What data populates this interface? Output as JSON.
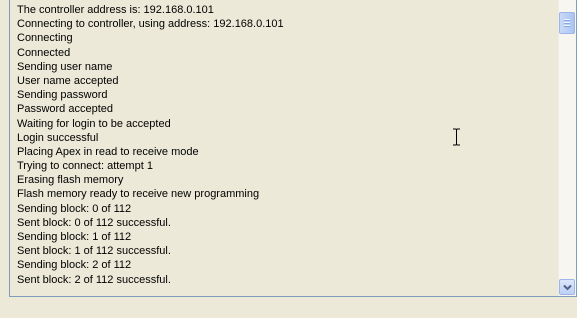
{
  "log": {
    "lines": [
      "The controller address is: 192.168.0.101",
      "Connecting to controller, using address: 192.168.0.101",
      "Connecting",
      "Connected",
      "Sending user name",
      "User name accepted",
      "Sending password",
      "Password accepted",
      "Waiting for login to be accepted",
      "Login successful",
      "Placing Apex in read to receive mode",
      "Trying to connect: attempt 1",
      "Erasing flash memory",
      "Flash memory ready to receive new programming",
      "Sending block: 0 of 112",
      "Sent block: 0 of 112 successful.",
      "Sending block: 1 of 112",
      "Sent block: 1 of 112 successful.",
      "Sending block: 2 of 112",
      "Sent block: 2 of 112 successful."
    ]
  },
  "scrollbar": {
    "thumb_icon": "grip-lines-icon",
    "down_icon": "chevron-down-icon",
    "colors": {
      "arrow": "#4d6185",
      "thumb": "#b7cdf6",
      "border": "#7f9db9"
    }
  },
  "cursor": {
    "icon": "text-cursor-ibeam-icon"
  }
}
